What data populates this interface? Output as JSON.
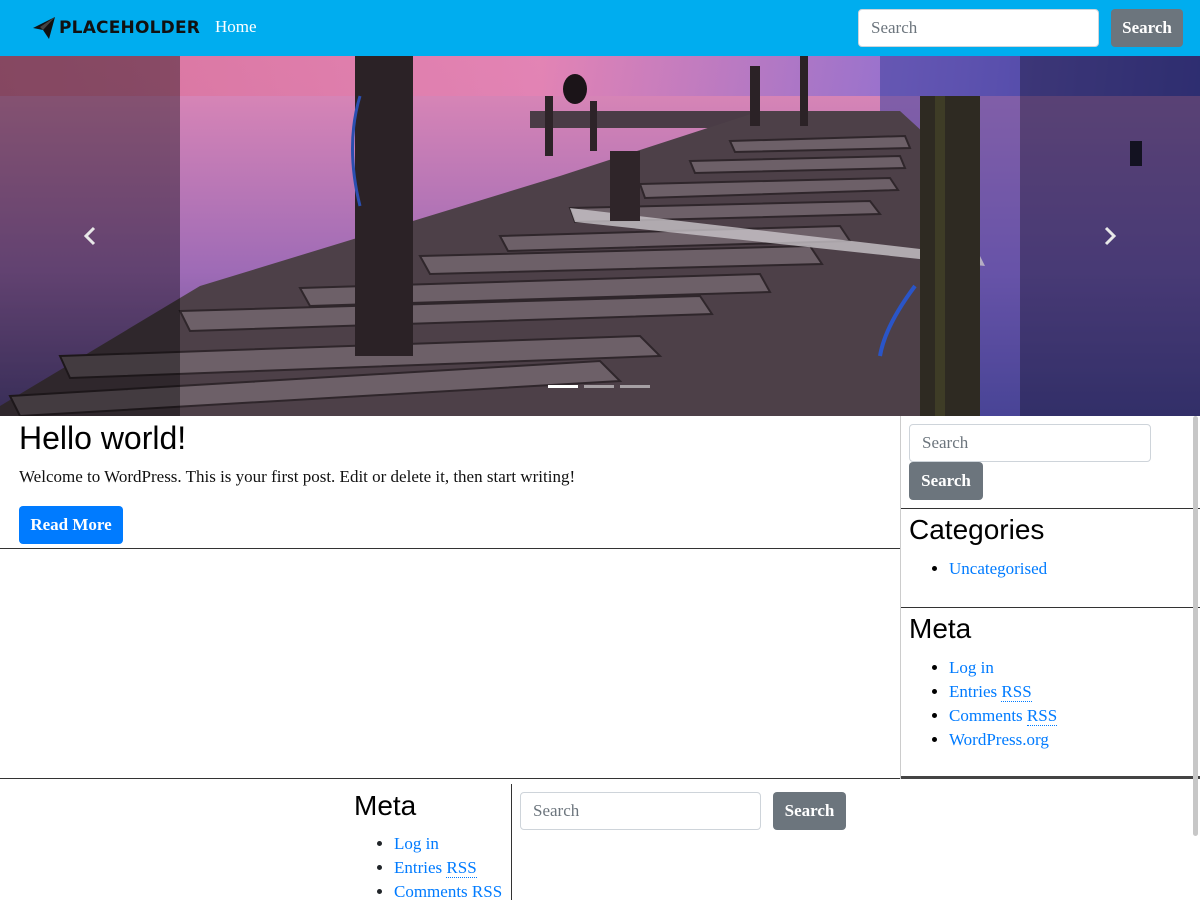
{
  "navbar": {
    "brand_text": "PLACEHOLDER",
    "brand_icon": "paper-plane-logo",
    "home_label": "Home",
    "search_placeholder": "Search",
    "search_button": "Search",
    "background_color": "#00adef"
  },
  "carousel": {
    "image_description_icon": "pier-sunset-image",
    "prev_icon": "chevron-left-icon",
    "next_icon": "chevron-right-icon",
    "indicator_count": 3,
    "active_indicator": 0
  },
  "post": {
    "title": "Hello world!",
    "excerpt": "Welcome to WordPress. This is your first post. Edit or delete it, then start writing!",
    "read_more": "Read More",
    "button_color": "#007bff"
  },
  "sidebar": {
    "search_placeholder": "Search",
    "search_button": "Search",
    "categories": {
      "title": "Categories",
      "items": [
        {
          "label": "Uncategorised"
        }
      ]
    },
    "meta": {
      "title": "Meta",
      "items": [
        {
          "label": "Log in"
        },
        {
          "label_prefix": "Entries ",
          "abbr": "RSS"
        },
        {
          "label_prefix": "Comments ",
          "abbr": "RSS"
        },
        {
          "label": "WordPress.org"
        }
      ]
    }
  },
  "footer": {
    "meta": {
      "title": "Meta",
      "items": [
        {
          "label": "Log in"
        },
        {
          "label_prefix": "Entries ",
          "abbr": "RSS"
        },
        {
          "label_prefix": "Comments ",
          "abbr": "RSS"
        }
      ]
    },
    "search_placeholder": "Search",
    "search_button": "Search"
  },
  "colors": {
    "link": "#007bff",
    "secondary_button": "#6c757d"
  }
}
